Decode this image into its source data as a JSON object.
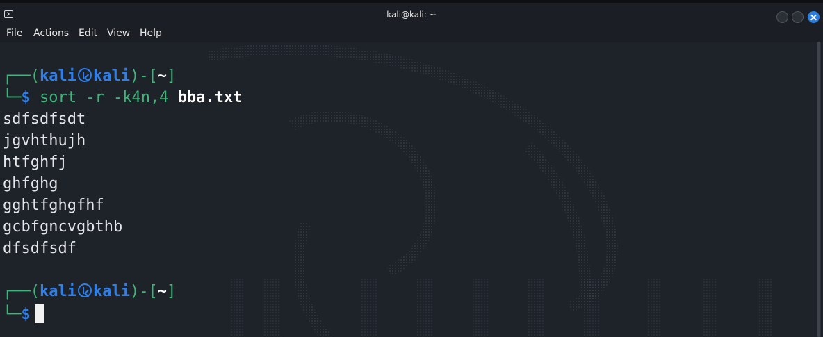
{
  "window": {
    "title": "kali@kali: ~",
    "icon": "terminal-icon",
    "buttons": [
      "minimize",
      "maximize",
      "close"
    ],
    "accent_color": "#2a7de1"
  },
  "menu": {
    "file": "File",
    "actions": "Actions",
    "edit": "Edit",
    "view": "View",
    "help": "Help"
  },
  "terminal": {
    "prompt1": {
      "corner_top": "┌──(",
      "user": "kali",
      "host": "kali",
      "after_host": ")-[",
      "dir": "~",
      "close": "]",
      "corner_bottom": "└─",
      "dollar": "$",
      "command": "sort -r -k4n,4 ",
      "argument": "bba.txt"
    },
    "output": [
      "sdfsdfsdt",
      "jgvhthujh",
      "htfghfj",
      "ghfghg",
      "gghtfghgfhf",
      "gcbfgncvgbthb",
      "dfsdfsdf"
    ],
    "prompt2": {
      "corner_top": "┌──(",
      "user": "kali",
      "host": "kali",
      "after_host": ")-[",
      "dir": "~",
      "close": "]",
      "corner_bottom": "└─",
      "dollar": "$"
    },
    "colors": {
      "background": "#1e2229",
      "green": "#3fb57a",
      "blue": "#2f7fe8",
      "text": "#e4e6ea"
    }
  }
}
